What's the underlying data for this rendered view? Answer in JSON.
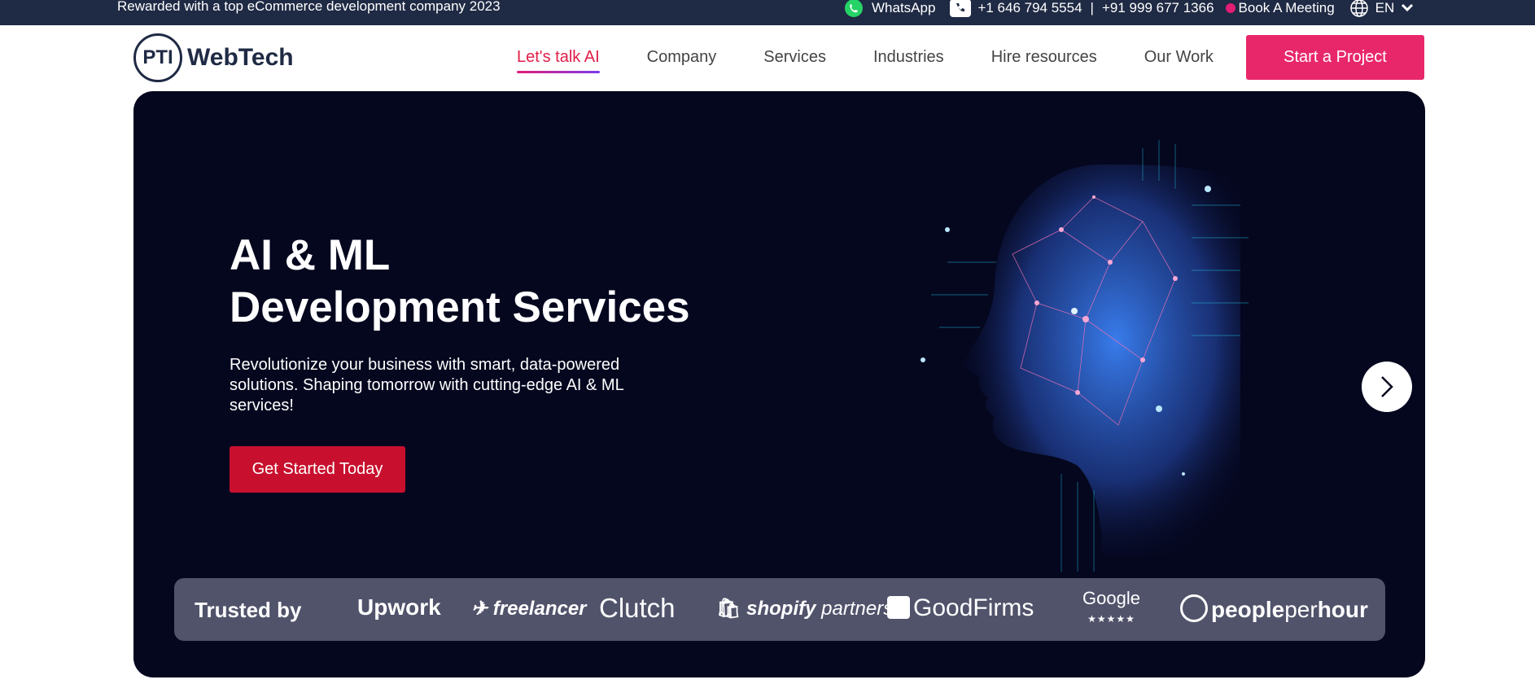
{
  "topbar": {
    "award": "Rewarded with a top eCommerce development company 2023",
    "whatsapp": "WhatsApp",
    "phone_us": "+1 646 794 5554",
    "separator": "|",
    "phone_in": "+91 999 677 1366",
    "meeting": "Book A Meeting",
    "language": "EN"
  },
  "logo": {
    "mark": "PTI",
    "name": "WebTech"
  },
  "nav": {
    "items": [
      {
        "label": "Let's talk AI"
      },
      {
        "label": "Company"
      },
      {
        "label": "Services"
      },
      {
        "label": "Industries"
      },
      {
        "label": "Hire resources"
      },
      {
        "label": "Our Work"
      }
    ],
    "cta": "Start a Project"
  },
  "hero": {
    "title_line1": "AI & ML",
    "title_line2": "Development Services",
    "subtitle": "Revolutionize your business with smart, data-powered solutions. Shaping tomorrow with cutting-edge AI & ML services!",
    "cta": "Get Started Today"
  },
  "trusted": {
    "label": "Trusted by",
    "brands": {
      "upwork": "Upwork",
      "freelancer": "freelancer",
      "clutch": "Clutch",
      "shopify_a": "shopify",
      "shopify_b": "partners",
      "goodfirms": "GoodFirms",
      "google": "Google",
      "pph_a": "people",
      "pph_b": "per",
      "pph_c": "hour"
    }
  },
  "colors": {
    "topbar": "#1f2a44",
    "accent_pink": "#e8276a",
    "hero_bg": "#05071f",
    "hero_cta": "#c8102e"
  }
}
